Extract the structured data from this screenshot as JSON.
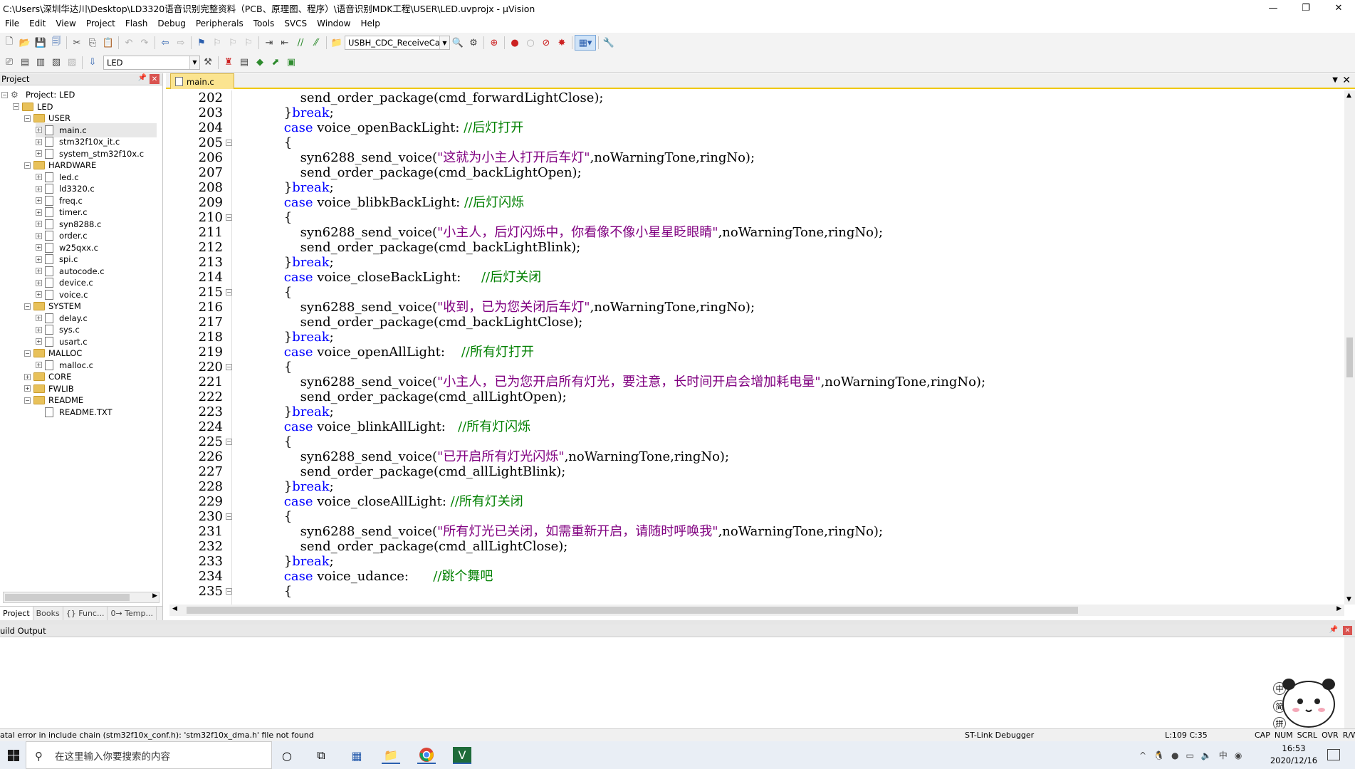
{
  "window": {
    "title": "C:\\Users\\深圳华达川\\Desktop\\LD3320语音识别完整资料（PCB、原理图、程序）\\语音识别MDK工程\\USER\\LED.uvprojx - µVision"
  },
  "menu": [
    "File",
    "Edit",
    "View",
    "Project",
    "Flash",
    "Debug",
    "Peripherals",
    "Tools",
    "SVCS",
    "Window",
    "Help"
  ],
  "toolbar": {
    "find_combo": "USBH_CDC_ReceiveCallb",
    "target_combo": "LED"
  },
  "project_panel": {
    "title": "Project",
    "items": [
      {
        "label": "Project: LED",
        "type": "project"
      },
      {
        "label": "LED",
        "type": "target"
      },
      {
        "label": "USER",
        "type": "group"
      },
      {
        "label": "main.c",
        "type": "file"
      },
      {
        "label": "stm32f10x_it.c",
        "type": "file"
      },
      {
        "label": "system_stm32f10x.c",
        "type": "file"
      },
      {
        "label": "HARDWARE",
        "type": "group"
      },
      {
        "label": "led.c",
        "type": "file"
      },
      {
        "label": "ld3320.c",
        "type": "file"
      },
      {
        "label": "freq.c",
        "type": "file"
      },
      {
        "label": "timer.c",
        "type": "file"
      },
      {
        "label": "syn8288.c",
        "type": "file"
      },
      {
        "label": "order.c",
        "type": "file"
      },
      {
        "label": "w25qxx.c",
        "type": "file"
      },
      {
        "label": "spi.c",
        "type": "file"
      },
      {
        "label": "autocode.c",
        "type": "file"
      },
      {
        "label": "device.c",
        "type": "file"
      },
      {
        "label": "voice.c",
        "type": "file"
      },
      {
        "label": "SYSTEM",
        "type": "group"
      },
      {
        "label": "delay.c",
        "type": "file"
      },
      {
        "label": "sys.c",
        "type": "file"
      },
      {
        "label": "usart.c",
        "type": "file"
      },
      {
        "label": "MALLOC",
        "type": "group"
      },
      {
        "label": "malloc.c",
        "type": "file"
      },
      {
        "label": "CORE",
        "type": "group-collapsed"
      },
      {
        "label": "FWLIB",
        "type": "group-collapsed"
      },
      {
        "label": "README",
        "type": "group"
      },
      {
        "label": "README.TXT",
        "type": "file-noexp"
      }
    ],
    "tabs": [
      "Project",
      "Books",
      "{} Func...",
      "0→ Temp..."
    ]
  },
  "editor": {
    "tab": "main.c",
    "lines": [
      {
        "n": "202",
        "fold": false,
        "code": [
          {
            "t": "            send_order_package(cmd_forwardLightClose);",
            "c": ""
          }
        ]
      },
      {
        "n": "203",
        "fold": false,
        "code": [
          {
            "t": "        }",
            "c": ""
          },
          {
            "t": "break",
            "c": "kw"
          },
          {
            "t": ";",
            "c": ""
          }
        ]
      },
      {
        "n": "204",
        "fold": false,
        "code": [
          {
            "t": "        ",
            "c": ""
          },
          {
            "t": "case",
            "c": "kw"
          },
          {
            "t": " voice_openBackLight: ",
            "c": ""
          },
          {
            "t": "//后灯打开",
            "c": "cm"
          }
        ]
      },
      {
        "n": "205",
        "fold": true,
        "code": [
          {
            "t": "        {",
            "c": ""
          }
        ]
      },
      {
        "n": "206",
        "fold": false,
        "code": [
          {
            "t": "            syn6288_send_voice(",
            "c": ""
          },
          {
            "t": "\"这就为小主人打开后车灯\"",
            "c": "str"
          },
          {
            "t": ",noWarningTone,ringNo);",
            "c": ""
          }
        ]
      },
      {
        "n": "207",
        "fold": false,
        "code": [
          {
            "t": "            send_order_package(cmd_backLightOpen);",
            "c": ""
          }
        ]
      },
      {
        "n": "208",
        "fold": false,
        "code": [
          {
            "t": "        }",
            "c": ""
          },
          {
            "t": "break",
            "c": "kw"
          },
          {
            "t": ";",
            "c": ""
          }
        ]
      },
      {
        "n": "209",
        "fold": false,
        "code": [
          {
            "t": "        ",
            "c": ""
          },
          {
            "t": "case",
            "c": "kw"
          },
          {
            "t": " voice_blibkBackLight: ",
            "c": ""
          },
          {
            "t": "//后灯闪烁",
            "c": "cm"
          }
        ]
      },
      {
        "n": "210",
        "fold": true,
        "code": [
          {
            "t": "        {",
            "c": ""
          }
        ]
      },
      {
        "n": "211",
        "fold": false,
        "code": [
          {
            "t": "            syn6288_send_voice(",
            "c": ""
          },
          {
            "t": "\"小主人，后灯闪烁中，你看像不像小星星眨眼睛\"",
            "c": "str"
          },
          {
            "t": ",noWarningTone,ringNo);",
            "c": ""
          }
        ]
      },
      {
        "n": "212",
        "fold": false,
        "code": [
          {
            "t": "            send_order_package(cmd_backLightBlink);",
            "c": ""
          }
        ]
      },
      {
        "n": "213",
        "fold": false,
        "code": [
          {
            "t": "        }",
            "c": ""
          },
          {
            "t": "break",
            "c": "kw"
          },
          {
            "t": ";",
            "c": ""
          }
        ]
      },
      {
        "n": "214",
        "fold": false,
        "code": [
          {
            "t": "        ",
            "c": ""
          },
          {
            "t": "case",
            "c": "kw"
          },
          {
            "t": " voice_closeBackLight:     ",
            "c": ""
          },
          {
            "t": "//后灯关闭",
            "c": "cm"
          }
        ]
      },
      {
        "n": "215",
        "fold": true,
        "code": [
          {
            "t": "        {",
            "c": ""
          }
        ]
      },
      {
        "n": "216",
        "fold": false,
        "code": [
          {
            "t": "            syn6288_send_voice(",
            "c": ""
          },
          {
            "t": "\"收到，已为您关闭后车灯\"",
            "c": "str"
          },
          {
            "t": ",noWarningTone,ringNo);",
            "c": ""
          }
        ]
      },
      {
        "n": "217",
        "fold": false,
        "code": [
          {
            "t": "            send_order_package(cmd_backLightClose);",
            "c": ""
          }
        ]
      },
      {
        "n": "218",
        "fold": false,
        "code": [
          {
            "t": "        }",
            "c": ""
          },
          {
            "t": "break",
            "c": "kw"
          },
          {
            "t": ";",
            "c": ""
          }
        ]
      },
      {
        "n": "219",
        "fold": false,
        "code": [
          {
            "t": "        ",
            "c": ""
          },
          {
            "t": "case",
            "c": "kw"
          },
          {
            "t": " voice_openAllLight:    ",
            "c": ""
          },
          {
            "t": "//所有灯打开",
            "c": "cm"
          }
        ]
      },
      {
        "n": "220",
        "fold": true,
        "code": [
          {
            "t": "        {",
            "c": ""
          }
        ]
      },
      {
        "n": "221",
        "fold": false,
        "code": [
          {
            "t": "            syn6288_send_voice(",
            "c": ""
          },
          {
            "t": "\"小主人，已为您开启所有灯光，要注意，长时间开启会增加耗电量\"",
            "c": "str"
          },
          {
            "t": ",noWarningTone,ringNo);",
            "c": ""
          }
        ]
      },
      {
        "n": "222",
        "fold": false,
        "code": [
          {
            "t": "            send_order_package(cmd_allLightOpen);",
            "c": ""
          }
        ]
      },
      {
        "n": "223",
        "fold": false,
        "code": [
          {
            "t": "        }",
            "c": ""
          },
          {
            "t": "break",
            "c": "kw"
          },
          {
            "t": ";",
            "c": ""
          }
        ]
      },
      {
        "n": "224",
        "fold": false,
        "code": [
          {
            "t": "        ",
            "c": ""
          },
          {
            "t": "case",
            "c": "kw"
          },
          {
            "t": " voice_blinkAllLight:   ",
            "c": ""
          },
          {
            "t": "//所有灯闪烁",
            "c": "cm"
          }
        ]
      },
      {
        "n": "225",
        "fold": true,
        "code": [
          {
            "t": "        {",
            "c": ""
          }
        ]
      },
      {
        "n": "226",
        "fold": false,
        "code": [
          {
            "t": "            syn6288_send_voice(",
            "c": ""
          },
          {
            "t": "\"已开启所有灯光闪烁\"",
            "c": "str"
          },
          {
            "t": ",noWarningTone,ringNo);",
            "c": ""
          }
        ]
      },
      {
        "n": "227",
        "fold": false,
        "code": [
          {
            "t": "            send_order_package(cmd_allLightBlink);",
            "c": ""
          }
        ]
      },
      {
        "n": "228",
        "fold": false,
        "code": [
          {
            "t": "        }",
            "c": ""
          },
          {
            "t": "break",
            "c": "kw"
          },
          {
            "t": ";",
            "c": ""
          }
        ]
      },
      {
        "n": "229",
        "fold": false,
        "code": [
          {
            "t": "        ",
            "c": ""
          },
          {
            "t": "case",
            "c": "kw"
          },
          {
            "t": " voice_closeAllLight: ",
            "c": ""
          },
          {
            "t": "//所有灯关闭",
            "c": "cm"
          }
        ]
      },
      {
        "n": "230",
        "fold": true,
        "code": [
          {
            "t": "        {",
            "c": ""
          }
        ]
      },
      {
        "n": "231",
        "fold": false,
        "code": [
          {
            "t": "            syn6288_send_voice(",
            "c": ""
          },
          {
            "t": "\"所有灯光已关闭，如需重新开启，请随时呼唤我\"",
            "c": "str"
          },
          {
            "t": ",noWarningTone,ringNo);",
            "c": ""
          }
        ]
      },
      {
        "n": "232",
        "fold": false,
        "code": [
          {
            "t": "            send_order_package(cmd_allLightClose);",
            "c": ""
          }
        ]
      },
      {
        "n": "233",
        "fold": false,
        "code": [
          {
            "t": "        }",
            "c": ""
          },
          {
            "t": "break",
            "c": "kw"
          },
          {
            "t": ";",
            "c": ""
          }
        ]
      },
      {
        "n": "234",
        "fold": false,
        "code": [
          {
            "t": "        ",
            "c": ""
          },
          {
            "t": "case",
            "c": "kw"
          },
          {
            "t": " voice_udance:      ",
            "c": ""
          },
          {
            "t": "//跳个舞吧",
            "c": "cm"
          }
        ]
      },
      {
        "n": "235",
        "fold": true,
        "code": [
          {
            "t": "        {",
            "c": ""
          }
        ]
      }
    ]
  },
  "build_output": {
    "title": "uild Output"
  },
  "statusbar": {
    "message": "atal error in include chain (stm32f10x_conf.h): 'stm32f10x_dma.h' file not found",
    "debugger": "ST-Link Debugger",
    "position": "L:109 C:35",
    "flags": [
      "CAP",
      "NUM",
      "SCRL",
      "OVR",
      "R/W"
    ]
  },
  "ime": [
    "中",
    "简",
    "拼"
  ],
  "taskbar": {
    "search_placeholder": "在这里输入你要搜索的内容",
    "time": "16:53",
    "date": "2020/12/16"
  }
}
